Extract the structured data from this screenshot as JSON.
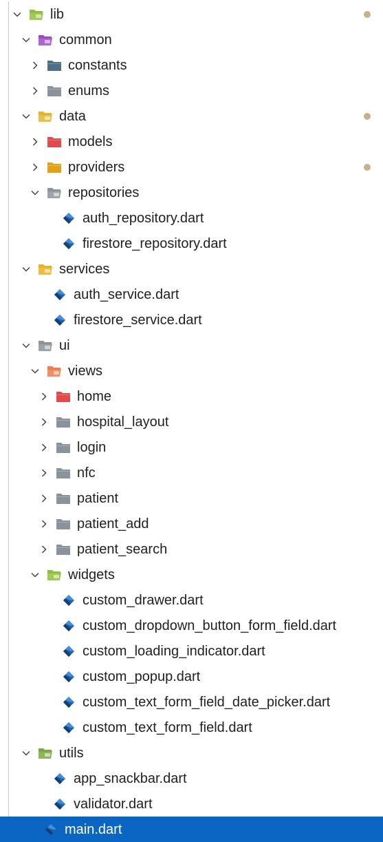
{
  "colors": {
    "selection": "#0a66c2",
    "modified_dot": "#c7b18a",
    "folder_gray": "#8a939c",
    "dart_blue": "#1f5fa8",
    "folder_lib": "#8fbf3a",
    "folder_common": "#a04bc6",
    "folder_data": "#e0b531",
    "folder_constants": "#4f6f86",
    "folder_models": "#e34b4b",
    "folder_providers": "#e2a317",
    "folder_services": "#e4b421",
    "folder_views": "#ef7c4c",
    "folder_home": "#e34b4b",
    "folder_widgets": "#8fbf3a",
    "folder_utils": "#7aa83c"
  },
  "explorer": {
    "items": [
      {
        "label": "lib",
        "level": 0,
        "kind": "folder",
        "expanded": true,
        "icon": "folder-lib-open-icon",
        "color": "#8fbf3a",
        "modified": true
      },
      {
        "label": "common",
        "level": 1,
        "kind": "folder",
        "expanded": true,
        "icon": "folder-common-open-icon",
        "color": "#a04bc6",
        "modified": false
      },
      {
        "label": "constants",
        "level": 2,
        "kind": "folder",
        "expanded": false,
        "icon": "folder-constants-icon",
        "color": "#4f6f86",
        "modified": false
      },
      {
        "label": "enums",
        "level": 2,
        "kind": "folder",
        "expanded": false,
        "icon": "folder-icon",
        "color": "#8a939c",
        "modified": false
      },
      {
        "label": "data",
        "level": 1,
        "kind": "folder",
        "expanded": true,
        "icon": "folder-data-open-icon",
        "color": "#e0b531",
        "modified": true
      },
      {
        "label": "models",
        "level": 2,
        "kind": "folder",
        "expanded": false,
        "icon": "folder-models-icon",
        "color": "#e34b4b",
        "modified": false
      },
      {
        "label": "providers",
        "level": 2,
        "kind": "folder",
        "expanded": false,
        "icon": "folder-providers-icon",
        "color": "#e2a317",
        "modified": true
      },
      {
        "label": "repositories",
        "level": 2,
        "kind": "folder",
        "expanded": true,
        "icon": "folder-open-icon",
        "color": "#8a939c",
        "modified": false
      },
      {
        "label": "auth_repository.dart",
        "level": 3,
        "kind": "file",
        "icon": "dart-file-icon",
        "color": "#1f5fa8",
        "modified": false
      },
      {
        "label": "firestore_repository.dart",
        "level": 3,
        "kind": "file",
        "icon": "dart-file-icon",
        "color": "#1f5fa8",
        "modified": false
      },
      {
        "label": "services",
        "level": 1,
        "kind": "folder",
        "expanded": true,
        "icon": "folder-services-open-icon",
        "color": "#e4b421",
        "modified": false
      },
      {
        "label": "auth_service.dart",
        "level": 2,
        "kind": "file",
        "icon": "dart-file-icon",
        "color": "#1f5fa8",
        "modified": false
      },
      {
        "label": "firestore_service.dart",
        "level": 2,
        "kind": "file",
        "icon": "dart-file-icon",
        "color": "#1f5fa8",
        "modified": false
      },
      {
        "label": "ui",
        "level": 1,
        "kind": "folder",
        "expanded": true,
        "icon": "folder-open-icon",
        "color": "#8a939c",
        "modified": false
      },
      {
        "label": "views",
        "level": 2,
        "kind": "folder",
        "expanded": true,
        "icon": "folder-views-open-icon",
        "color": "#ef7c4c",
        "modified": false
      },
      {
        "label": "home",
        "level": 3,
        "kind": "folder",
        "expanded": false,
        "icon": "folder-home-icon",
        "color": "#e34b4b",
        "modified": false
      },
      {
        "label": "hospital_layout",
        "level": 3,
        "kind": "folder",
        "expanded": false,
        "icon": "folder-icon",
        "color": "#8a939c",
        "modified": false
      },
      {
        "label": "login",
        "level": 3,
        "kind": "folder",
        "expanded": false,
        "icon": "folder-icon",
        "color": "#8a939c",
        "modified": false
      },
      {
        "label": "nfc",
        "level": 3,
        "kind": "folder",
        "expanded": false,
        "icon": "folder-icon",
        "color": "#8a939c",
        "modified": false
      },
      {
        "label": "patient",
        "level": 3,
        "kind": "folder",
        "expanded": false,
        "icon": "folder-icon",
        "color": "#8a939c",
        "modified": false
      },
      {
        "label": "patient_add",
        "level": 3,
        "kind": "folder",
        "expanded": false,
        "icon": "folder-icon",
        "color": "#8a939c",
        "modified": false
      },
      {
        "label": "patient_search",
        "level": 3,
        "kind": "folder",
        "expanded": false,
        "icon": "folder-icon",
        "color": "#8a939c",
        "modified": false
      },
      {
        "label": "widgets",
        "level": 2,
        "kind": "folder",
        "expanded": true,
        "icon": "folder-widgets-open-icon",
        "color": "#8fbf3a",
        "modified": false
      },
      {
        "label": "custom_drawer.dart",
        "level": 3,
        "kind": "file",
        "icon": "dart-file-icon",
        "color": "#1f5fa8",
        "modified": false
      },
      {
        "label": "custom_dropdown_button_form_field.dart",
        "level": 3,
        "kind": "file",
        "icon": "dart-file-icon",
        "color": "#1f5fa8",
        "modified": false
      },
      {
        "label": "custom_loading_indicator.dart",
        "level": 3,
        "kind": "file",
        "icon": "dart-file-icon",
        "color": "#1f5fa8",
        "modified": false
      },
      {
        "label": "custom_popup.dart",
        "level": 3,
        "kind": "file",
        "icon": "dart-file-icon",
        "color": "#1f5fa8",
        "modified": false
      },
      {
        "label": "custom_text_form_field_date_picker.dart",
        "level": 3,
        "kind": "file",
        "icon": "dart-file-icon",
        "color": "#1f5fa8",
        "modified": false
      },
      {
        "label": "custom_text_form_field.dart",
        "level": 3,
        "kind": "file",
        "icon": "dart-file-icon",
        "color": "#1f5fa8",
        "modified": false
      },
      {
        "label": "utils",
        "level": 1,
        "kind": "folder",
        "expanded": true,
        "icon": "folder-utils-open-icon",
        "color": "#7aa83c",
        "modified": false
      },
      {
        "label": "app_snackbar.dart",
        "level": 2,
        "kind": "file",
        "icon": "dart-file-icon",
        "color": "#1f5fa8",
        "modified": false
      },
      {
        "label": "validator.dart",
        "level": 2,
        "kind": "file",
        "icon": "dart-file-icon",
        "color": "#1f5fa8",
        "modified": false
      },
      {
        "label": "main.dart",
        "level": 1,
        "kind": "file",
        "icon": "dart-file-icon",
        "color": "#1f5fa8",
        "modified": false,
        "selected": true
      }
    ]
  }
}
